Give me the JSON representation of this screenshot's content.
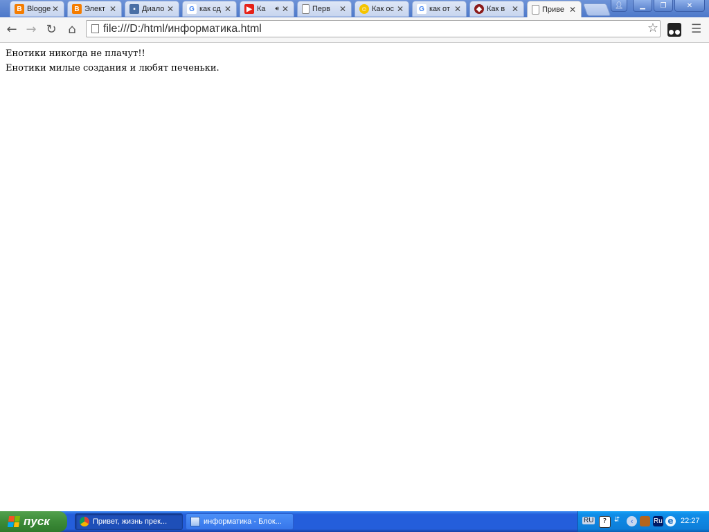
{
  "browser": {
    "tabs": [
      {
        "title": "Blogge",
        "icon": "blogger-icon",
        "color": "#f57d00",
        "glyph": "B",
        "active": false
      },
      {
        "title": "Элект",
        "icon": "blogger-icon",
        "color": "#f57d00",
        "glyph": "B",
        "active": false
      },
      {
        "title": "Диало",
        "icon": "chat-icon",
        "color": "#4a6fa5",
        "glyph": "▪",
        "active": false
      },
      {
        "title": "как сд",
        "icon": "google-icon",
        "color": "#4285f4",
        "glyph": "G",
        "active": false
      },
      {
        "title": "Ка",
        "icon": "youtube-icon",
        "color": "#e62117",
        "glyph": "▶",
        "active": false,
        "audio": true
      },
      {
        "title": "Перв",
        "icon": "page-icon",
        "color": "#ffffff",
        "glyph": "",
        "active": false
      },
      {
        "title": "Как ос",
        "icon": "smiley-icon",
        "color": "#f5c400",
        "glyph": "☺",
        "active": false
      },
      {
        "title": "как от",
        "icon": "google-icon",
        "color": "#4285f4",
        "glyph": "G",
        "active": false
      },
      {
        "title": "Как в",
        "icon": "site-icon",
        "color": "#8b1a1a",
        "glyph": "◆",
        "active": false
      },
      {
        "title": "Приве",
        "icon": "page-icon",
        "color": "#ffffff",
        "glyph": "",
        "active": true
      }
    ],
    "url": "file:///D:/html/информатика.html"
  },
  "page": {
    "line1": "Енотики никогда не плачут!!",
    "line2": "Енотики милые создания и любят печеньки."
  },
  "taskbar": {
    "start_label": "пуск",
    "buttons": [
      {
        "label": "Привет, жизнь прек...",
        "icon": "chrome-icon",
        "active": true
      },
      {
        "label": "информатика - Блок...",
        "icon": "notepad-icon",
        "active": false
      }
    ],
    "tray": {
      "lang": "RU",
      "lang_indicator": "Ru",
      "clock": "22:27"
    }
  }
}
